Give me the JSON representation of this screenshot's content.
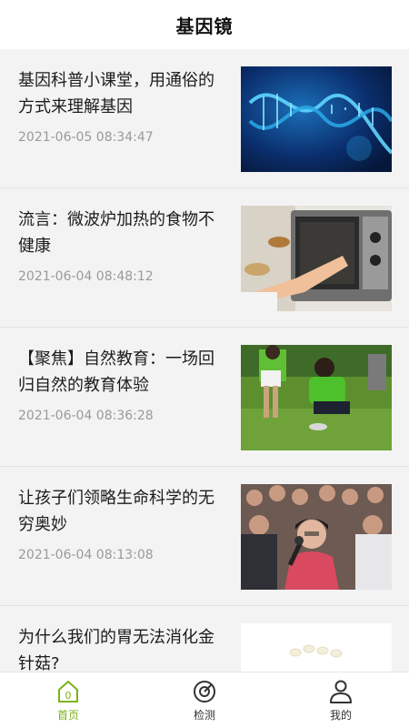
{
  "header": {
    "title": "基因镜"
  },
  "articles": [
    {
      "title": "基因科普小课堂，用通俗的方式来理解基因",
      "time": "2021-06-05 08:34:47",
      "image": "dna-helix"
    },
    {
      "title": "流言：微波炉加热的食物不健康",
      "time": "2021-06-04 08:48:12",
      "image": "microwave-oven"
    },
    {
      "title": "【聚焦】自然教育：一场回归自然的教育体验",
      "time": "2021-06-04 08:36:28",
      "image": "children-in-nature"
    },
    {
      "title": "让孩子们领略生命科学的无穷奥妙",
      "time": "2021-06-04 08:13:08",
      "image": "girl-with-microphone"
    },
    {
      "title": "为什么我们的胃无法消化金针菇?",
      "time": "",
      "image": "enoki-mushroom"
    }
  ],
  "tabbar": {
    "accent": "#7ab317",
    "tabs": [
      {
        "label": "首页",
        "icon": "home-icon",
        "active": true
      },
      {
        "label": "检测",
        "icon": "scan-icon",
        "active": false
      },
      {
        "label": "我的",
        "icon": "user-icon",
        "active": false
      }
    ]
  }
}
